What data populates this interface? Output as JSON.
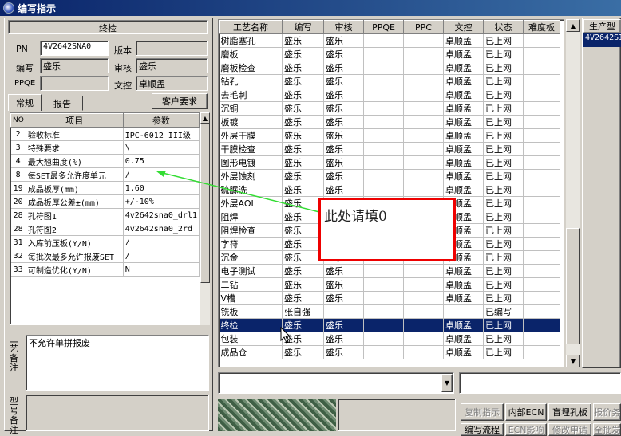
{
  "window": {
    "title": "编写指示"
  },
  "left_panel": {
    "section_title": "终检",
    "fields": {
      "pn_label": "PN",
      "pn_value": "4V2642SNA0",
      "version_label": "版本",
      "version_value": "",
      "author_label": "编写",
      "author_value": "盛乐",
      "review_label": "审核",
      "review_value": "盛乐",
      "ppqe_label": "PPQE",
      "ppqe_value": "",
      "doc_label": "文控",
      "doc_value": "卓顺孟"
    },
    "tabs": [
      "常规",
      "报告"
    ],
    "customer_req_button": "客户要求",
    "param_grid": {
      "headers": [
        "NO",
        "项目",
        "参数"
      ],
      "rows": [
        [
          "2",
          "验收标准",
          "IPC-6012 III级"
        ],
        [
          "3",
          "特殊要求",
          "\\"
        ],
        [
          "4",
          "最大翘曲度(%)",
          "0.75"
        ],
        [
          "8",
          "每SET最多允许度单元",
          "/"
        ],
        [
          "19",
          "成品板厚(mm)",
          "1.60"
        ],
        [
          "20",
          "成品板厚公差±(mm)",
          "+/-10%"
        ],
        [
          "28",
          "孔符图1",
          "4v2642sna0_drl1"
        ],
        [
          "28",
          "孔符图2",
          "4v2642sna0_2rd"
        ],
        [
          "31",
          "入库前压板(Y/N)",
          "/"
        ],
        [
          "32",
          "每批次最多允许报废SET",
          "/"
        ],
        [
          "33",
          "可制造优化(Y/N)",
          "N"
        ]
      ]
    },
    "process_note_label": "工艺备注",
    "process_note_value": "不允许单拼报废",
    "model_note_label": "型号备注"
  },
  "main_grid": {
    "headers": [
      "工艺名称",
      "编写",
      "审核",
      "PPQE",
      "PPC",
      "文控",
      "状态",
      "难度板"
    ],
    "rows": [
      [
        "树脂塞孔",
        "盛乐",
        "盛乐",
        "",
        "",
        "卓顺孟",
        "已上网",
        ""
      ],
      [
        "磨板",
        "盛乐",
        "盛乐",
        "",
        "",
        "卓顺孟",
        "已上网",
        ""
      ],
      [
        "磨板检查",
        "盛乐",
        "盛乐",
        "",
        "",
        "卓顺孟",
        "已上网",
        ""
      ],
      [
        "钻孔",
        "盛乐",
        "盛乐",
        "",
        "",
        "卓顺孟",
        "已上网",
        ""
      ],
      [
        "去毛刺",
        "盛乐",
        "盛乐",
        "",
        "",
        "卓顺孟",
        "已上网",
        ""
      ],
      [
        "沉铜",
        "盛乐",
        "盛乐",
        "",
        "",
        "卓顺孟",
        "已上网",
        ""
      ],
      [
        "板镀",
        "盛乐",
        "盛乐",
        "",
        "",
        "卓顺孟",
        "已上网",
        ""
      ],
      [
        "外层干膜",
        "盛乐",
        "盛乐",
        "",
        "",
        "卓顺孟",
        "已上网",
        ""
      ],
      [
        "干膜检查",
        "盛乐",
        "盛乐",
        "",
        "",
        "卓顺孟",
        "已上网",
        ""
      ],
      [
        "图形电镀",
        "盛乐",
        "盛乐",
        "",
        "",
        "卓顺孟",
        "已上网",
        ""
      ],
      [
        "外层蚀刻",
        "盛乐",
        "盛乐",
        "",
        "",
        "卓顺孟",
        "已上网",
        ""
      ],
      [
        "硫脲洗",
        "盛乐",
        "盛乐",
        "",
        "",
        "卓顺孟",
        "已上网",
        ""
      ],
      [
        "外层AOI",
        "盛乐",
        "盛乐",
        "",
        "",
        "卓顺孟",
        "已上网",
        ""
      ],
      [
        "阻焊",
        "盛乐",
        "盛乐",
        "",
        "",
        "卓顺孟",
        "已上网",
        ""
      ],
      [
        "阻焊检查",
        "盛乐",
        "盛乐",
        "",
        "",
        "卓顺孟",
        "已上网",
        ""
      ],
      [
        "字符",
        "盛乐",
        "盛乐",
        "",
        "",
        "卓顺孟",
        "已上网",
        ""
      ],
      [
        "沉金",
        "盛乐",
        "盛乐",
        "",
        "",
        "卓顺孟",
        "已上网",
        ""
      ],
      [
        "电子测试",
        "盛乐",
        "盛乐",
        "",
        "",
        "卓顺孟",
        "已上网",
        ""
      ],
      [
        "二钻",
        "盛乐",
        "盛乐",
        "",
        "",
        "卓顺孟",
        "已上网",
        ""
      ],
      [
        "V槽",
        "盛乐",
        "盛乐",
        "",
        "",
        "卓顺孟",
        "已上网",
        ""
      ],
      [
        "铣板",
        "张自强",
        "",
        "",
        "",
        "",
        "已编写",
        ""
      ],
      [
        "终检",
        "盛乐",
        "盛乐",
        "",
        "",
        "卓顺孟",
        "已上网",
        ""
      ],
      [
        "包装",
        "盛乐",
        "盛乐",
        "",
        "",
        "卓顺孟",
        "已上网",
        ""
      ],
      [
        "成品仓",
        "盛乐",
        "盛乐",
        "",
        "",
        "卓顺孟",
        "已上网",
        ""
      ]
    ],
    "selected_row": 21
  },
  "right_panel": {
    "header": "生产型",
    "value": "4V2642SI"
  },
  "annotation": {
    "text": "此处请填0",
    "color": "#ee0000"
  },
  "bottom_buttons": {
    "copy_instruction": "复制指示",
    "internal_ecn": "内部ECN",
    "blind_buried": "盲埋孔板",
    "quote": "报价务",
    "edit_flow": "编写流程",
    "ecn_impact": "ECN影响",
    "modify_apply": "修改申请",
    "all_batch": "全批发"
  }
}
